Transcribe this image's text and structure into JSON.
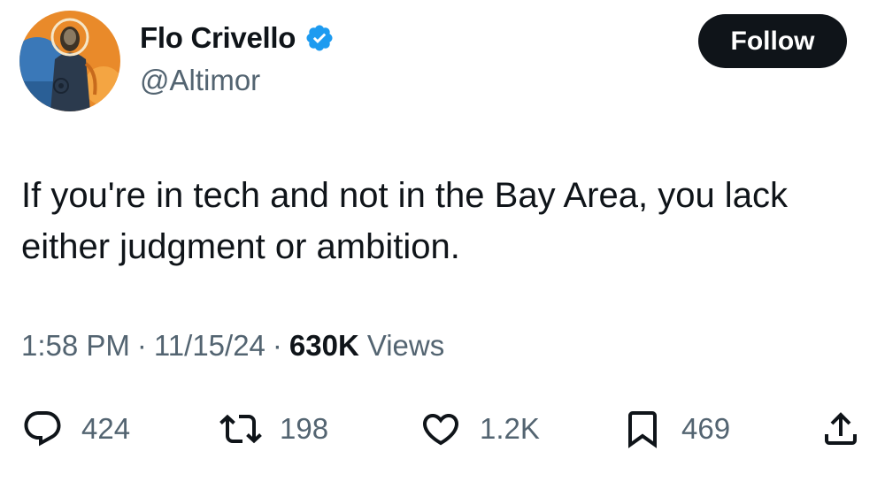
{
  "user": {
    "display_name": "Flo Crivello",
    "handle": "@Altimor",
    "verified": true,
    "verified_color": "#1d9bf0"
  },
  "follow_button": {
    "label": "Follow"
  },
  "tweet": {
    "text": "If you're in tech and not in the Bay Area, you lack either judgment or ambition."
  },
  "meta": {
    "time": "1:58 PM",
    "date": "11/15/24",
    "separator": "·",
    "views_count": "630K",
    "views_label": "Views"
  },
  "actions": {
    "replies": {
      "icon": "reply-icon",
      "count": "424"
    },
    "reposts": {
      "icon": "repost-icon",
      "count": "198"
    },
    "likes": {
      "icon": "heart-icon",
      "count": "1.2K"
    },
    "bookmarks": {
      "icon": "bookmark-icon",
      "count": "469"
    },
    "share": {
      "icon": "share-icon"
    }
  },
  "colors": {
    "text_primary": "#0f1419",
    "text_secondary": "#536471",
    "follow_bg": "#0f1419"
  }
}
